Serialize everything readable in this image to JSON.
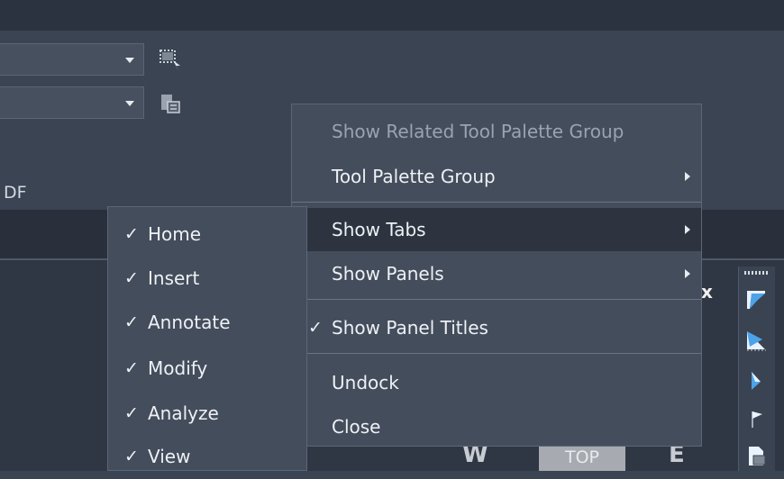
{
  "ribbon": {
    "pdf_label_fragment": "DF"
  },
  "context_menu": {
    "items": [
      {
        "label": "Show Related Tool Palette Group",
        "disabled": true
      },
      {
        "label": "Tool Palette Group",
        "submenu": true
      },
      {
        "label": "Show Tabs",
        "submenu": true,
        "highlighted": true
      },
      {
        "label": "Show Panels",
        "submenu": true
      },
      {
        "label": "Show Panel Titles",
        "checked": true,
        "check_mark": "✓"
      },
      {
        "label": "Undock"
      },
      {
        "label": "Close"
      }
    ]
  },
  "tabs_submenu": {
    "check_mark": "✓",
    "items": [
      {
        "label": "Home",
        "checked": true
      },
      {
        "label": "Insert",
        "checked": true
      },
      {
        "label": "Annotate",
        "checked": true
      },
      {
        "label": "Modify",
        "checked": true
      },
      {
        "label": "Analyze",
        "checked": true
      },
      {
        "label": "View",
        "checked": true
      }
    ]
  },
  "viewport": {
    "close_symbol": "x",
    "viewcube": {
      "west": "W",
      "top": "TOP",
      "east": "E"
    }
  },
  "icons": {
    "ribbon": [
      "select-object-icon",
      "paste-clipboard-icon"
    ],
    "right_toolbar": [
      "view-front-icon",
      "view-bottom-icon",
      "view-left-icon",
      "flag-icon",
      "document-icon"
    ]
  },
  "colors": {
    "menu_bg": "#444d5c",
    "menu_highlight": "#2d3440",
    "panel_bg": "#3b4453",
    "tabstrip_bg": "#2a303b"
  }
}
